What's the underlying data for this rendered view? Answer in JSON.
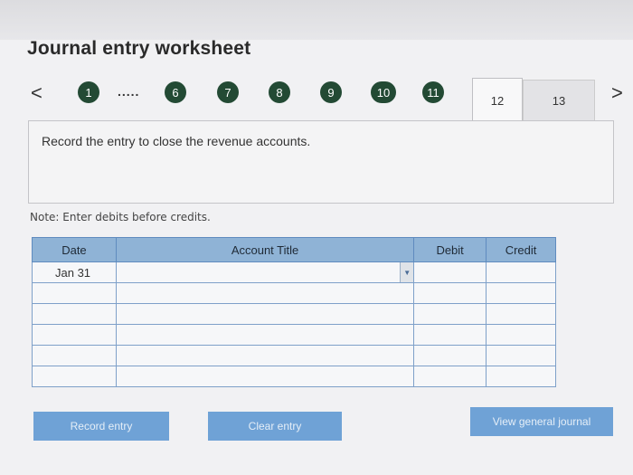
{
  "worksheet": {
    "title": "Journal entry worksheet",
    "nav": {
      "prev_icon": "chevron-left-icon",
      "next_icon": "chevron-right-icon",
      "prev_glyph": "<",
      "next_glyph": ">",
      "steps": [
        "1",
        "6",
        "7",
        "8",
        "9",
        "10",
        "11"
      ],
      "ellipsis": ".....",
      "active_tab": "12",
      "next_tab": "13"
    },
    "instruction": "Record the entry to close the revenue accounts.",
    "note": "Note: Enter debits before credits."
  },
  "table": {
    "headers": {
      "date": "Date",
      "account": "Account Title",
      "debit": "Debit",
      "credit": "Credit"
    },
    "rows": [
      {
        "date": "Jan 31",
        "account": "",
        "debit": "",
        "credit": ""
      },
      {
        "date": "",
        "account": "",
        "debit": "",
        "credit": ""
      },
      {
        "date": "",
        "account": "",
        "debit": "",
        "credit": ""
      },
      {
        "date": "",
        "account": "",
        "debit": "",
        "credit": ""
      },
      {
        "date": "",
        "account": "",
        "debit": "",
        "credit": ""
      },
      {
        "date": "",
        "account": "",
        "debit": "",
        "credit": ""
      }
    ]
  },
  "buttons": {
    "record": "Record entry",
    "clear": "Clear entry",
    "view": "View general journal"
  },
  "colors": {
    "step_circle": "#234a34",
    "table_header": "#8fb3d6",
    "button": "#6fa2d6"
  }
}
